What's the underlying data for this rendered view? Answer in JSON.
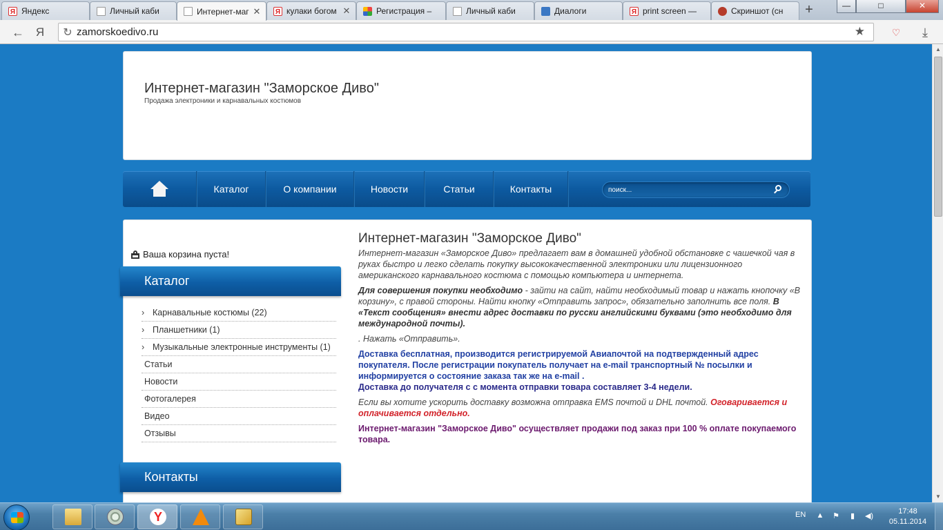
{
  "browser": {
    "tabs": [
      {
        "label": "Яндекс",
        "favicon": "yandex-icon",
        "active": false
      },
      {
        "label": "Личный каби",
        "favicon": "page-icon",
        "active": false
      },
      {
        "label": "Интернет-маг",
        "favicon": "page-icon",
        "active": true
      },
      {
        "label": "кулаки богом",
        "favicon": "yandex-icon",
        "active": false
      },
      {
        "label": "Регистрация –",
        "favicon": "registration-icon",
        "active": false
      },
      {
        "label": "Личный каби",
        "favicon": "page-icon",
        "active": false
      },
      {
        "label": "Диалоги",
        "favicon": "dialogs-icon",
        "active": false
      },
      {
        "label": "print screen —",
        "favicon": "yandex-icon",
        "active": false
      },
      {
        "label": "Скриншот (сн",
        "favicon": "screenshot-icon",
        "active": false
      }
    ],
    "new_tab": "+",
    "url": "zamorskoedivo.ru",
    "yandex_button": "Я",
    "window_controls": {
      "minimize": "—",
      "maximize": "□",
      "close": "✕"
    }
  },
  "site": {
    "title": "Интернет-магазин \"Заморское Диво\"",
    "subtitle": "Продажа электроники и карнавальных костюмов"
  },
  "nav": {
    "items": [
      "Каталог",
      "О компании",
      "Новости",
      "Статьи",
      "Контакты"
    ],
    "search_placeholder": "поиск..."
  },
  "sidebar": {
    "cart_text": "Ваша корзина пуста!",
    "catalog_header": "Каталог",
    "catalog_sub": [
      "Карнавальные костюмы (22)",
      "Планшетники (1)",
      "Музыкальные электронные инструменты (1)"
    ],
    "catalog_top": [
      "Статьи",
      "Новости",
      "Фотогалерея",
      "Видео",
      "Отзывы"
    ],
    "contacts_header": "Контакты"
  },
  "content": {
    "title": "Интернет-магазин \"Заморское Диво\"",
    "intro": "Интернет-магазин «Заморское Диво» предлагает вам в домашней удобной обстановке с чашечкой чая в руках быстро и легко сделать покупку высококачественной электроники или лицензионного американского карнавального костюма с помощью компьютера и интернета.",
    "howto_bold": "Для совершения покупки необходимо",
    "howto_text": " - зайти на сайт, найти необходимый товар и нажать кнопочку «В корзину», с правой стороны.  Найти  кнопку «Отправить запрос», обязательно заполнить все поля. ",
    "howto_bold2": "В «Текст сообщения» внести адрес доставки  по русски английскими буквами (это необходимо для международной почты).",
    "howto_end": ". Нажать «Отправить».",
    "delivery": "Доставка бесплатная,  производится регистрируемой Авиапочтой на подтвержденный адрес покупателя.  После регистрации покупатель получает на  e-mail  транспортный № посылки и информируется  о состояние заказа так же на  e-mail .",
    "delivery_time": "Доставка до получателя с  с момента отправки товара составляет  3-4 недели.",
    "ems_text": "Если вы хотите ускорить доставку возможна отправка EMS почтой  и DHL почтой. ",
    "ems_red": "Оговаривается и оплачивается отдельно.",
    "prepay": "Интернет-магазин \"Заморское Диво\" осуществляет продажи под заказ при 100 % оплате покупаемого товара."
  },
  "taskbar": {
    "apps": [
      "explorer-icon",
      "chrome-icon",
      "yandex-browser-icon",
      "vlc-icon",
      "archive-icon"
    ],
    "lang": "EN",
    "time": "17:48",
    "date": "05.11.2014"
  },
  "colors": {
    "page_bg": "#1b7bc4",
    "nav_bg": "#0d5aa0",
    "blue_text": "#2241a3",
    "red_text": "#d2232a",
    "purple_text": "#6b1a6e"
  }
}
